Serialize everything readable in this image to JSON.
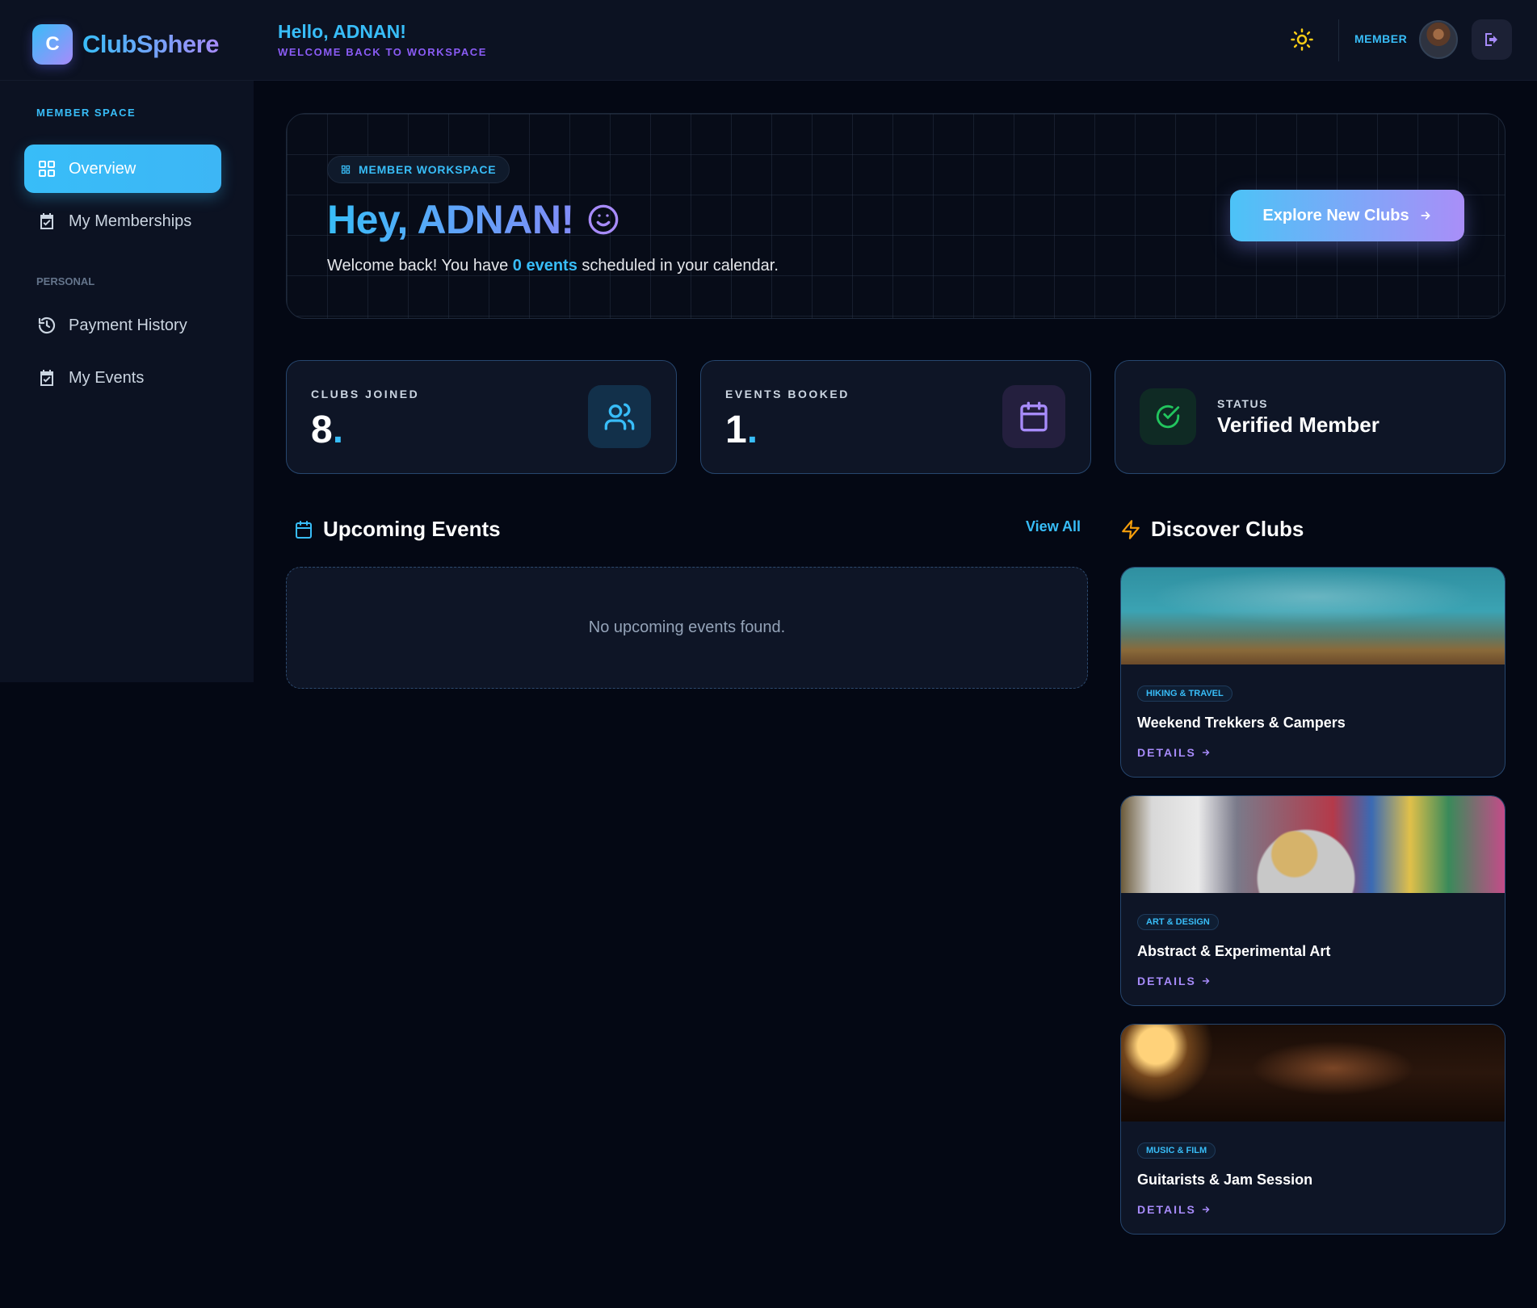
{
  "brand": {
    "logo_letter": "C",
    "name": "ClubSphere"
  },
  "header": {
    "greeting": "Hello, ADNAN!",
    "subtitle": "WELCOME BACK TO WORKSPACE",
    "role": "MEMBER",
    "theme_icon": "sun-icon",
    "logout_icon": "logout-icon"
  },
  "sidebar": {
    "section_member": "MEMBER SPACE",
    "section_personal": "PERSONAL",
    "items": [
      {
        "label": "Overview",
        "icon": "grid-icon",
        "active": true
      },
      {
        "label": "My Memberships",
        "icon": "calendar-check-icon"
      },
      {
        "label": "Payment History",
        "icon": "history-icon"
      },
      {
        "label": "My Events",
        "icon": "calendar-check-icon"
      }
    ]
  },
  "hero": {
    "pill": "MEMBER WORKSPACE",
    "title": "Hey, ADNAN!",
    "text_before": "Welcome back! You have ",
    "text_highlight": "0 events",
    "text_after": " scheduled in your calendar.",
    "cta": "Explore New Clubs"
  },
  "stats": [
    {
      "label": "CLUBS JOINED",
      "value": "8",
      "dot": ".",
      "icon": "users-icon"
    },
    {
      "label": "EVENTS BOOKED",
      "value": "1",
      "dot": ".",
      "icon": "calendar-icon"
    },
    {
      "label": "STATUS",
      "value": "Verified Member",
      "icon": "check-circle-icon"
    }
  ],
  "upcoming": {
    "title": "Upcoming Events",
    "view_all": "View All",
    "empty": "No upcoming events found."
  },
  "discover": {
    "title": "Discover Clubs",
    "clubs": [
      {
        "tag": "HIKING & TRAVEL",
        "name": "Weekend Trekkers & Campers",
        "details": "DETAILS"
      },
      {
        "tag": "ART & DESIGN",
        "name": "Abstract & Experimental Art",
        "details": "DETAILS"
      },
      {
        "tag": "MUSIC & FILM",
        "name": "Guitarists & Jam Session",
        "details": "DETAILS"
      }
    ]
  },
  "colors": {
    "background": "#040814",
    "panel": "#0c1222",
    "accent_blue": "#38bdf8",
    "accent_purple": "#a78bfa",
    "success": "#22c55e"
  }
}
